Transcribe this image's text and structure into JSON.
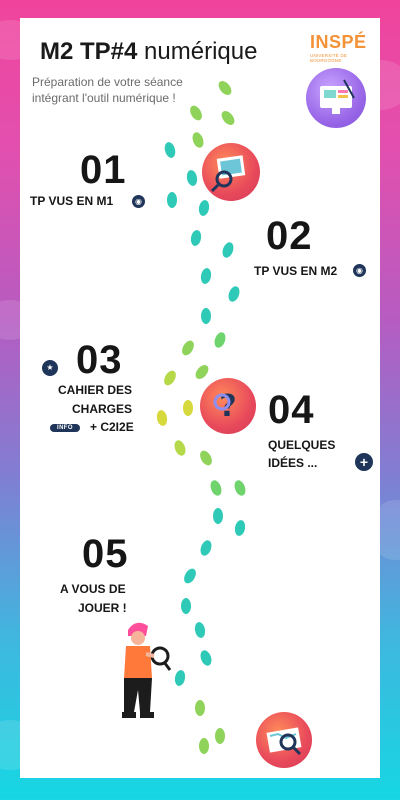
{
  "header": {
    "title_bold": "M2 TP#4",
    "title_rest": "numérique",
    "subtitle_line1": "Préparation de votre séance",
    "subtitle_line2": "intégrant l'outil numérique !",
    "logo_brand": "INSPÉ",
    "logo_university": "UNIVERSITÉ DE BOURGOGNE"
  },
  "steps": [
    {
      "number": "01",
      "label": "TP VUS EN  M1"
    },
    {
      "number": "02",
      "label": "TP VUS EN M2"
    },
    {
      "number": "03",
      "label_line1": "CAHIER DES",
      "label_line2": "CHARGES",
      "label_line3": "+ C2I2E",
      "tag": "INFO"
    },
    {
      "number": "04",
      "label_line1": "QUELQUES",
      "label_line2": "IDÉES ..."
    },
    {
      "number": "05",
      "label_line1": "A VOUS DE",
      "label_line2": "JOUER !"
    }
  ],
  "icons": {
    "pin": "location-pin-icon",
    "star": "star-pin-icon",
    "plus": "plus-icon"
  },
  "colors": {
    "accent_navy": "#1f3559",
    "logo_orange": "#f39237",
    "badge_red": "#e8495b",
    "footprint_teal": "#2ec9b7",
    "footprint_green": "#8fd35a",
    "footprint_yellow": "#d6d93c"
  }
}
